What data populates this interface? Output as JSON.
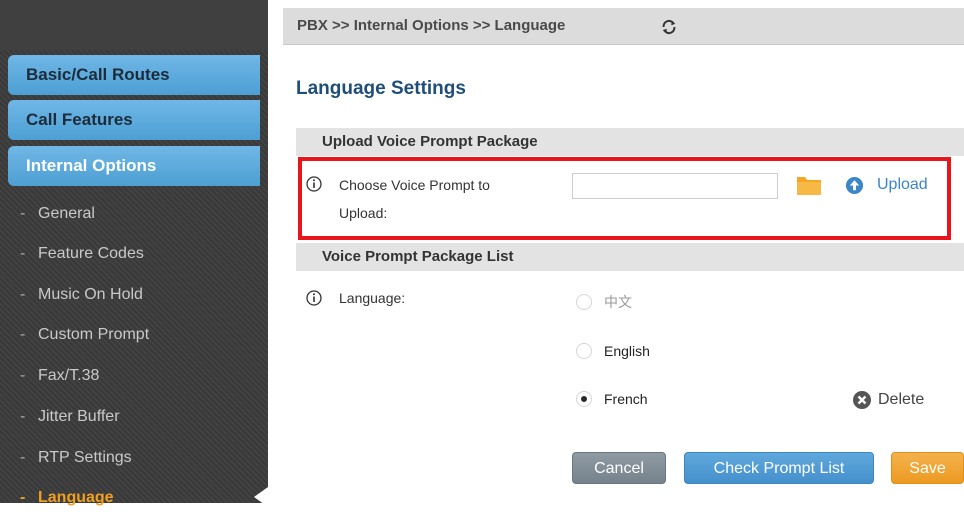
{
  "breadcrumb": "PBX >> Internal Options >> Language",
  "sidebar": {
    "categories": [
      {
        "label": "Basic/Call Routes"
      },
      {
        "label": "Call Features"
      },
      {
        "label": "Internal Options"
      }
    ],
    "sub_items": [
      {
        "label": "General"
      },
      {
        "label": "Feature Codes"
      },
      {
        "label": "Music On Hold"
      },
      {
        "label": "Custom Prompt"
      },
      {
        "label": "Fax/T.38"
      },
      {
        "label": "Jitter Buffer"
      },
      {
        "label": "RTP Settings"
      },
      {
        "label": "Language"
      }
    ],
    "dash": "-"
  },
  "main": {
    "title": "Language Settings",
    "upload_section": {
      "heading": "Upload Voice Prompt Package",
      "label_line1": "Choose Voice Prompt to",
      "label_line2": "Upload:",
      "file_value": "",
      "upload_label": "Upload"
    },
    "list_section": {
      "heading": "Voice Prompt Package List",
      "language_label": "Language:",
      "options": [
        {
          "label": "中文",
          "checked": false,
          "disabled": true
        },
        {
          "label": "English",
          "checked": false,
          "disabled": false
        },
        {
          "label": "French",
          "checked": true,
          "disabled": false
        }
      ],
      "delete_label": "Delete"
    },
    "buttons": {
      "cancel": "Cancel",
      "check": "Check Prompt List",
      "save": "Save"
    }
  },
  "colors": {
    "accent_blue": "#4d9fd4",
    "title_blue": "#1f4e79",
    "active_orange": "#f0a020",
    "highlight_red": "#e8161b",
    "save_orange": "#ec9a22"
  }
}
